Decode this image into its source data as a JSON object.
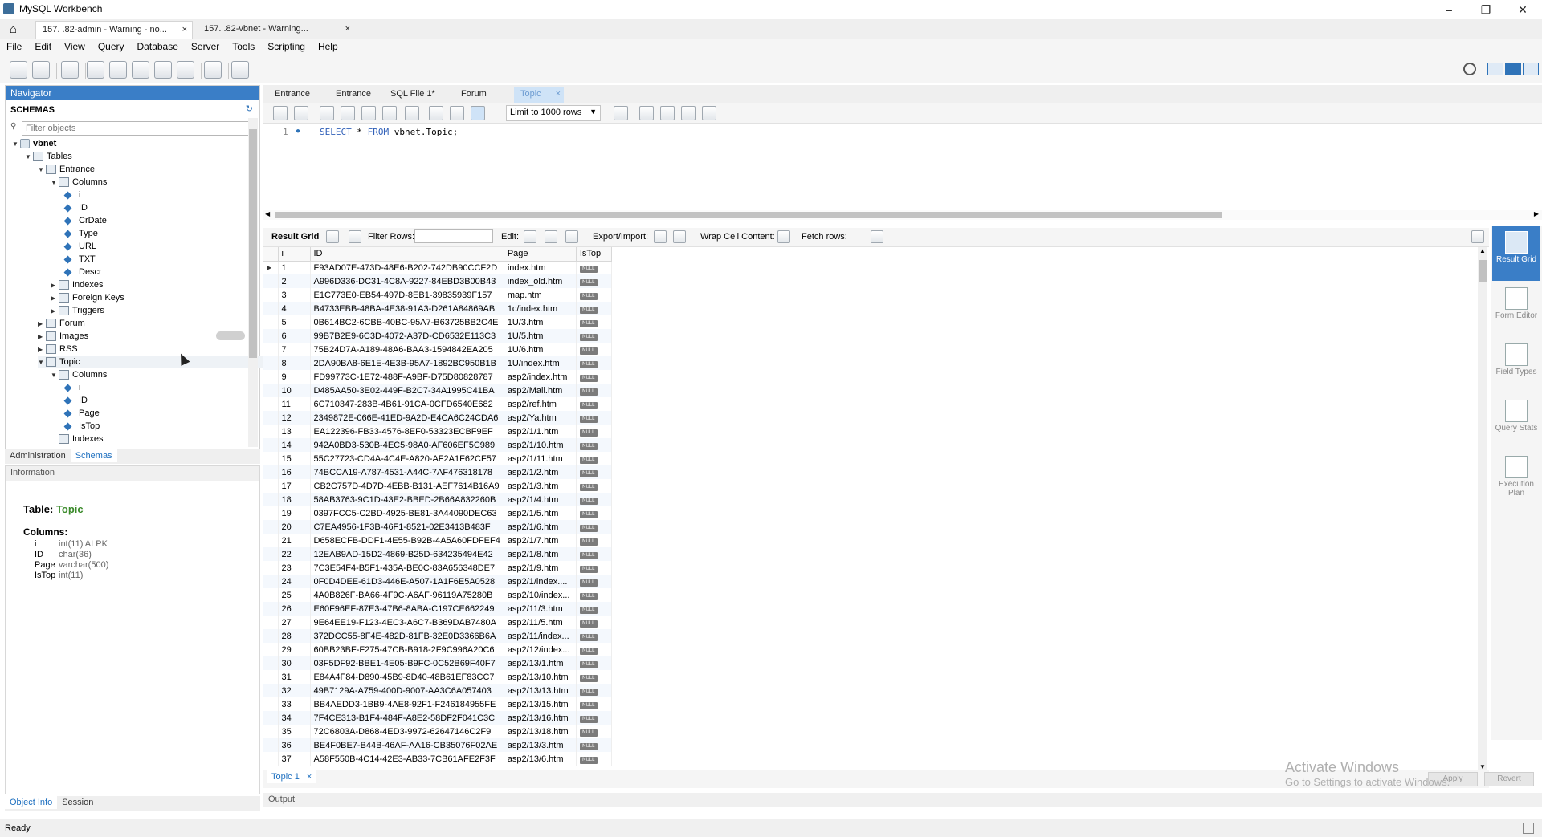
{
  "app": {
    "title": "MySQL Workbench",
    "conn_tabs": [
      {
        "label": "157.      .82-admin - Warning - no..."
      },
      {
        "label": "157.      .82-vbnet - Warning..."
      }
    ]
  },
  "menu": [
    "File",
    "Edit",
    "View",
    "Query",
    "Database",
    "Server",
    "Tools",
    "Scripting",
    "Help"
  ],
  "navigator": {
    "header": "Navigator",
    "schemas_label": "SCHEMAS",
    "filter_placeholder": "Filter objects",
    "tree": [
      {
        "label": "vbnet",
        "indent": 0
      },
      {
        "label": "Tables",
        "indent": 1
      },
      {
        "label": "Entrance",
        "indent": 2
      },
      {
        "label": "Columns",
        "indent": 3
      },
      {
        "label": "i",
        "indent": 4
      },
      {
        "label": "ID",
        "indent": 4
      },
      {
        "label": "CrDate",
        "indent": 4
      },
      {
        "label": "Type",
        "indent": 4
      },
      {
        "label": "URL",
        "indent": 4
      },
      {
        "label": "TXT",
        "indent": 4
      },
      {
        "label": "Descr",
        "indent": 4
      },
      {
        "label": "Indexes",
        "indent": 3
      },
      {
        "label": "Foreign Keys",
        "indent": 3
      },
      {
        "label": "Triggers",
        "indent": 3
      },
      {
        "label": "Forum",
        "indent": 2
      },
      {
        "label": "Images",
        "indent": 2
      },
      {
        "label": "RSS",
        "indent": 2
      },
      {
        "label": "Topic",
        "indent": 2
      },
      {
        "label": "Columns",
        "indent": 3
      },
      {
        "label": "i",
        "indent": 4
      },
      {
        "label": "ID",
        "indent": 4
      },
      {
        "label": "Page",
        "indent": 4
      },
      {
        "label": "IsTop",
        "indent": 4
      },
      {
        "label": "Indexes",
        "indent": 3
      }
    ],
    "bottom_tabs": [
      "Administration",
      "Schemas"
    ]
  },
  "info": {
    "header": "Information",
    "table_label": "Table:",
    "table_name": "Topic",
    "columns_label": "Columns:",
    "columns": [
      {
        "name": "i",
        "type": "int(11) AI PK"
      },
      {
        "name": "ID",
        "type": "char(36)"
      },
      {
        "name": "Page",
        "type": "varchar(500)"
      },
      {
        "name": "IsTop",
        "type": "int(11)"
      }
    ],
    "bottom_tabs": [
      "Object Info",
      "Session"
    ]
  },
  "editor": {
    "tabs": [
      "Entrance",
      "Entrance",
      "SQL File 1*",
      "Forum",
      "Topic"
    ],
    "limit": "Limit to 1000 rows",
    "line_number": "1",
    "sql_keyword_1": "SELECT",
    "sql_mid": " * ",
    "sql_keyword_2": "FROM",
    "sql_rest": " vbnet.Topic;"
  },
  "result_toolbar": {
    "result_grid": "Result Grid",
    "filter_rows": "Filter Rows:",
    "edit": "Edit:",
    "export_import": "Export/Import:",
    "wrap": "Wrap Cell Content:",
    "fetch": "Fetch rows:"
  },
  "grid": {
    "columns": [
      "i",
      "ID",
      "Page",
      "IsTop"
    ],
    "null_text": "NULL",
    "rows": [
      [
        "1",
        "F93AD07E-473D-48E6-B202-742DB90CCF2D",
        "index.htm"
      ],
      [
        "2",
        "A996D336-DC31-4C8A-9227-84EBD3B00B43",
        "index_old.htm"
      ],
      [
        "3",
        "E1C773E0-EB54-497D-8EB1-39835939F157",
        "map.htm"
      ],
      [
        "4",
        "B4733EBB-48BA-4E38-91A3-D261A84869AB",
        "1c/index.htm"
      ],
      [
        "5",
        "0B614BC2-6CBB-40BC-95A7-B63725BB2C4E",
        "1U/3.htm"
      ],
      [
        "6",
        "99B7B2E9-6C3D-4072-A37D-CD6532E113C3",
        "1U/5.htm"
      ],
      [
        "7",
        "75B24D7A-A189-48A6-BAA3-1594842EA205",
        "1U/6.htm"
      ],
      [
        "8",
        "2DA90BA8-6E1E-4E3B-95A7-1892BC950B1B",
        "1U/index.htm"
      ],
      [
        "9",
        "FD99773C-1E72-488F-A9BF-D75D80828787",
        "asp2/index.htm"
      ],
      [
        "10",
        "D485AA50-3E02-449F-B2C7-34A1995C41BA",
        "asp2/Mail.htm"
      ],
      [
        "11",
        "6C710347-283B-4B61-91CA-0CFD6540E682",
        "asp2/ref.htm"
      ],
      [
        "12",
        "2349872E-066E-41ED-9A2D-E4CA6C24CDA6",
        "asp2/Ya.htm"
      ],
      [
        "13",
        "EA122396-FB33-4576-8EF0-53323ECBF9EF",
        "asp2/1/1.htm"
      ],
      [
        "14",
        "942A0BD3-530B-4EC5-98A0-AF606EF5C989",
        "asp2/1/10.htm"
      ],
      [
        "15",
        "55C27723-CD4A-4C4E-A820-AF2A1F62CF57",
        "asp2/1/11.htm"
      ],
      [
        "16",
        "74BCCA19-A787-4531-A44C-7AF476318178",
        "asp2/1/2.htm"
      ],
      [
        "17",
        "CB2C757D-4D7D-4EBB-B131-AEF7614B16A9",
        "asp2/1/3.htm"
      ],
      [
        "18",
        "58AB3763-9C1D-43E2-BBED-2B66A832260B",
        "asp2/1/4.htm"
      ],
      [
        "19",
        "0397FCC5-C2BD-4925-BE81-3A44090DEC63",
        "asp2/1/5.htm"
      ],
      [
        "20",
        "C7EA4956-1F3B-46F1-8521-02E3413B483F",
        "asp2/1/6.htm"
      ],
      [
        "21",
        "D658ECFB-DDF1-4E55-B92B-4A5A60FDFEF4",
        "asp2/1/7.htm"
      ],
      [
        "22",
        "12EAB9AD-15D2-4869-B25D-634235494E42",
        "asp2/1/8.htm"
      ],
      [
        "23",
        "7C3E54F4-B5F1-435A-BE0C-83A656348DE7",
        "asp2/1/9.htm"
      ],
      [
        "24",
        "0F0D4DEE-61D3-446E-A507-1A1F6E5A0528",
        "asp2/1/index...."
      ],
      [
        "25",
        "4A0B826F-BA66-4F9C-A6AF-96119A75280B",
        "asp2/10/index..."
      ],
      [
        "26",
        "E60F96EF-87E3-47B6-8ABA-C197CE662249",
        "asp2/11/3.htm"
      ],
      [
        "27",
        "9E64EE19-F123-4EC3-A6C7-B369DAB7480A",
        "asp2/11/5.htm"
      ],
      [
        "28",
        "372DCC55-8F4E-482D-81FB-32E0D3366B6A",
        "asp2/11/index..."
      ],
      [
        "29",
        "60BB23BF-F275-47CB-B918-2F9C996A20C6",
        "asp2/12/index..."
      ],
      [
        "30",
        "03F5DF92-BBE1-4E05-B9FC-0C52B69F40F7",
        "asp2/13/1.htm"
      ],
      [
        "31",
        "E84A4F84-D890-45B9-8D40-48B61EF83CC7",
        "asp2/13/10.htm"
      ],
      [
        "32",
        "49B7129A-A759-400D-9007-AA3C6A057403",
        "asp2/13/13.htm"
      ],
      [
        "33",
        "BB4AEDD3-1BB9-4AE8-92F1-F246184955FE",
        "asp2/13/15.htm"
      ],
      [
        "34",
        "7F4CE313-B1F4-484F-A8E2-58DF2F041C3C",
        "asp2/13/16.htm"
      ],
      [
        "35",
        "72C6803A-D868-4ED3-9972-62647146C2F9",
        "asp2/13/18.htm"
      ],
      [
        "36",
        "BE4F0BE7-B44B-46AF-AA16-CB35076F02AE",
        "asp2/13/3.htm"
      ],
      [
        "37",
        "A58F550B-4C14-42E3-AB33-7CB61AFE2F3F",
        "asp2/13/6.htm"
      ]
    ]
  },
  "side_panel": [
    "Result Grid",
    "Form Editor",
    "Field Types",
    "Query Stats",
    "Execution Plan"
  ],
  "result_tab": "Topic 1",
  "output_label": "Output",
  "buttons": {
    "apply": "Apply",
    "revert": "Revert"
  },
  "status": "Ready",
  "watermark": {
    "line1": "Activate Windows",
    "line2": "Go to Settings to activate Windows."
  },
  "colors": {
    "accent": "#3a7ec7",
    "tab_active": "#cfe3f7",
    "null_badge": "#7b7b7b"
  }
}
